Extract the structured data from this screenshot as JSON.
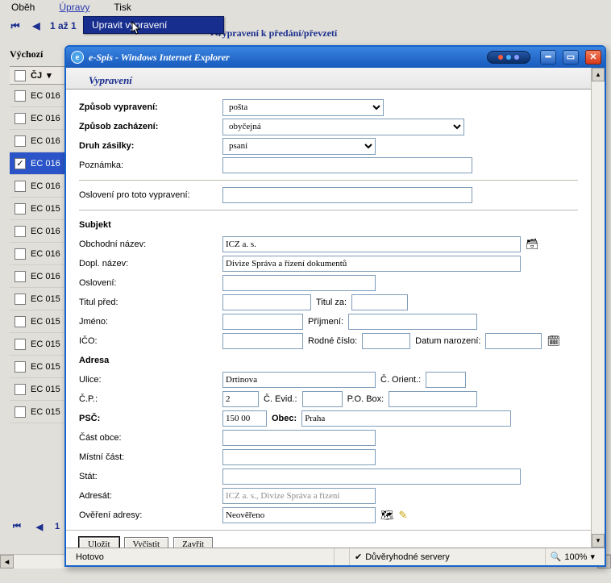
{
  "app": {
    "menu": {
      "obeh": "Oběh",
      "upravy": "Úpravy",
      "tisk": "Tisk"
    },
    "tooltip": "Upravit vypravení",
    "range": "1 až 1",
    "cross": "✕",
    "subtitle": "Vypravení k předání/převzetí",
    "sideLabel": "Výchozí",
    "th_cj": "ČJ",
    "rows": [
      {
        "label": "EC 016",
        "selected": false
      },
      {
        "label": "EC 016",
        "selected": false
      },
      {
        "label": "EC 016",
        "selected": false
      },
      {
        "label": "EC 016",
        "selected": true
      },
      {
        "label": "EC 016",
        "selected": false
      },
      {
        "label": "EC 015",
        "selected": false
      },
      {
        "label": "EC 016",
        "selected": false
      },
      {
        "label": "EC 016",
        "selected": false
      },
      {
        "label": "EC 016",
        "selected": false
      },
      {
        "label": "EC 015",
        "selected": false
      },
      {
        "label": "EC 015",
        "selected": false
      },
      {
        "label": "EC 015",
        "selected": false
      },
      {
        "label": "EC 015",
        "selected": false
      },
      {
        "label": "EC 015",
        "selected": false
      },
      {
        "label": "EC 015",
        "selected": false
      }
    ],
    "footer_range": "1"
  },
  "window": {
    "title": "e-Spis - Windows Internet Explorer",
    "panel_title": "Vypravení"
  },
  "form": {
    "zpusob_vypraveni_l": "Způsob vypravení:",
    "zpusob_vypraveni_v": "pošta",
    "zpusob_zachazeni_l": "Způsob zacházení:",
    "zpusob_zachazeni_v": "obyčejná",
    "druh_zasilky_l": "Druh zásilky:",
    "druh_zasilky_v": "psaní",
    "poznamka_l": "Poznámka:",
    "poznamka_v": "",
    "osloveni_toto_l": "Oslovení pro toto vypravení:",
    "osloveni_toto_v": "",
    "subjekt_h": "Subjekt",
    "obchodni_nazev_l": "Obchodní název:",
    "obchodni_nazev_v": "ICZ a. s.",
    "dopl_nazev_l": "Dopl. název:",
    "dopl_nazev_v": "Divize Správa a řízení dokumentů",
    "osloveni_l": "Oslovení:",
    "osloveni_v": "",
    "titul_pred_l": "Titul před:",
    "titul_pred_v": "",
    "titul_za_l": "Titul za:",
    "titul_za_v": "",
    "jmeno_l": "Jméno:",
    "jmeno_v": "",
    "prijmeni_l": "Příjmení:",
    "prijmeni_v": "",
    "ico_l": "IČO:",
    "ico_v": "",
    "rodne_cislo_l": "Rodné číslo:",
    "rodne_cislo_v": "",
    "datum_narozeni_l": "Datum narození:",
    "datum_narozeni_v": "",
    "adresa_h": "Adresa",
    "ulice_l": "Ulice:",
    "ulice_v": "Drtinova",
    "c_orient_l": "Č. Orient.:",
    "c_orient_v": "",
    "cp_l": "Č.P.:",
    "cp_v": "2",
    "c_evid_l": "Č. Evid.:",
    "c_evid_v": "",
    "po_box_l": "P.O. Box:",
    "po_box_v": "",
    "psc_l": "PSČ:",
    "psc_v": "150 00",
    "obec_l": "Obec:",
    "obec_v": "Praha",
    "cast_obce_l": "Část obce:",
    "cast_obce_v": "",
    "mistni_cast_l": "Místní část:",
    "mistni_cast_v": "",
    "stat_l": "Stát:",
    "stat_v": "",
    "adresat_l": "Adresát:",
    "adresat_v": "ICZ a. s., Divize Správa a řízení",
    "overeni_l": "Ověření adresy:",
    "overeni_v": "Neověřeno"
  },
  "buttons": {
    "ulozit": "Uložit",
    "vycistit": "Vyčistit",
    "zavrit": "Zavřít"
  },
  "status": {
    "hotovo": "Hotovo",
    "zone": "Důvěryhodné servery",
    "zoom": "100%"
  }
}
